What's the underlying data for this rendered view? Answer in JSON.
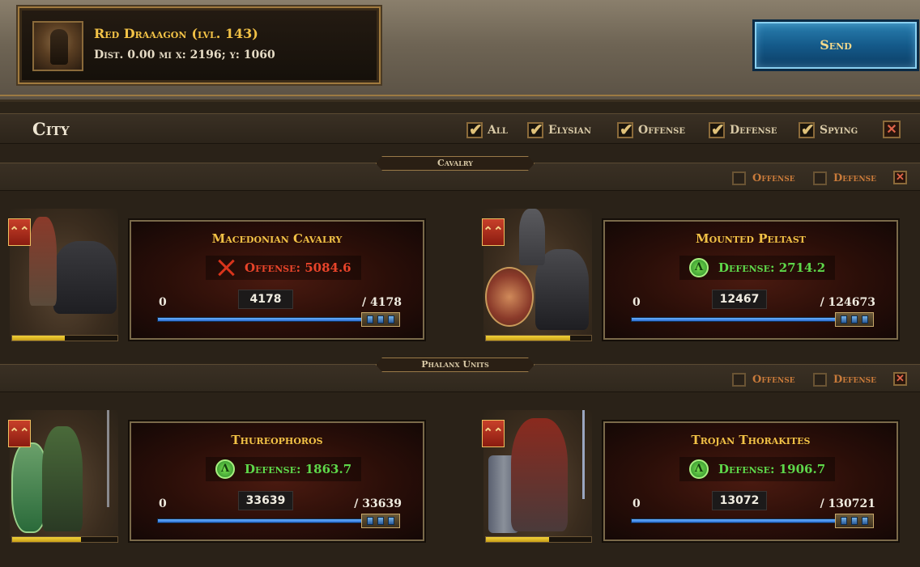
{
  "target": {
    "name": "Red Draaagon",
    "level": "(lvl. 143)",
    "distance": "Dist. 0.00 mi  x: 2196; y: 1060"
  },
  "send_label": "Send",
  "city": {
    "title": "City",
    "filters": [
      {
        "label": "All",
        "checked": true
      },
      {
        "label": "Elysian",
        "checked": true
      },
      {
        "label": "Offense",
        "checked": true
      },
      {
        "label": "Defense",
        "checked": true
      },
      {
        "label": "Spying",
        "checked": true
      }
    ],
    "clear_label": "✕"
  },
  "sections": [
    {
      "title": "Cavalry",
      "offense_label": "Offense",
      "defense_label": "Defense",
      "clear_label": "✕",
      "units": [
        {
          "name": "Macedonian Cavalry",
          "stat_type": "offense",
          "stat": "Offense: 5084.6",
          "min": "0",
          "value": "4178",
          "max": "/ 4178",
          "fill": 1.0,
          "health": 0.5,
          "rank": "⌃⌃"
        },
        {
          "name": "Mounted Peltast",
          "stat_type": "defense",
          "stat": "Defense: 2714.2",
          "min": "0",
          "value": "12467",
          "max": "/ 124673",
          "fill": 1.0,
          "health": 0.8,
          "rank": "⌃⌃"
        }
      ]
    },
    {
      "title": "Phalanx Units",
      "offense_label": "Offense",
      "defense_label": "Defense",
      "clear_label": "✕",
      "units": [
        {
          "name": "Thureophoros",
          "stat_type": "defense",
          "stat": "Defense: 1863.7",
          "min": "0",
          "value": "33639",
          "max": "/ 33639",
          "fill": 1.0,
          "health": 0.65,
          "rank": "⌃⌃"
        },
        {
          "name": "Trojan Thorakites",
          "stat_type": "defense",
          "stat": "Defense: 1906.7",
          "min": "0",
          "value": "13072",
          "max": "/ 130721",
          "fill": 1.0,
          "health": 0.6,
          "rank": "⌃⌃"
        }
      ]
    }
  ],
  "colors": {
    "gold_text": "#f2c246",
    "offense_red": "#e8442a",
    "defense_green": "#5ed84a",
    "send_blue": "#145a8a"
  }
}
